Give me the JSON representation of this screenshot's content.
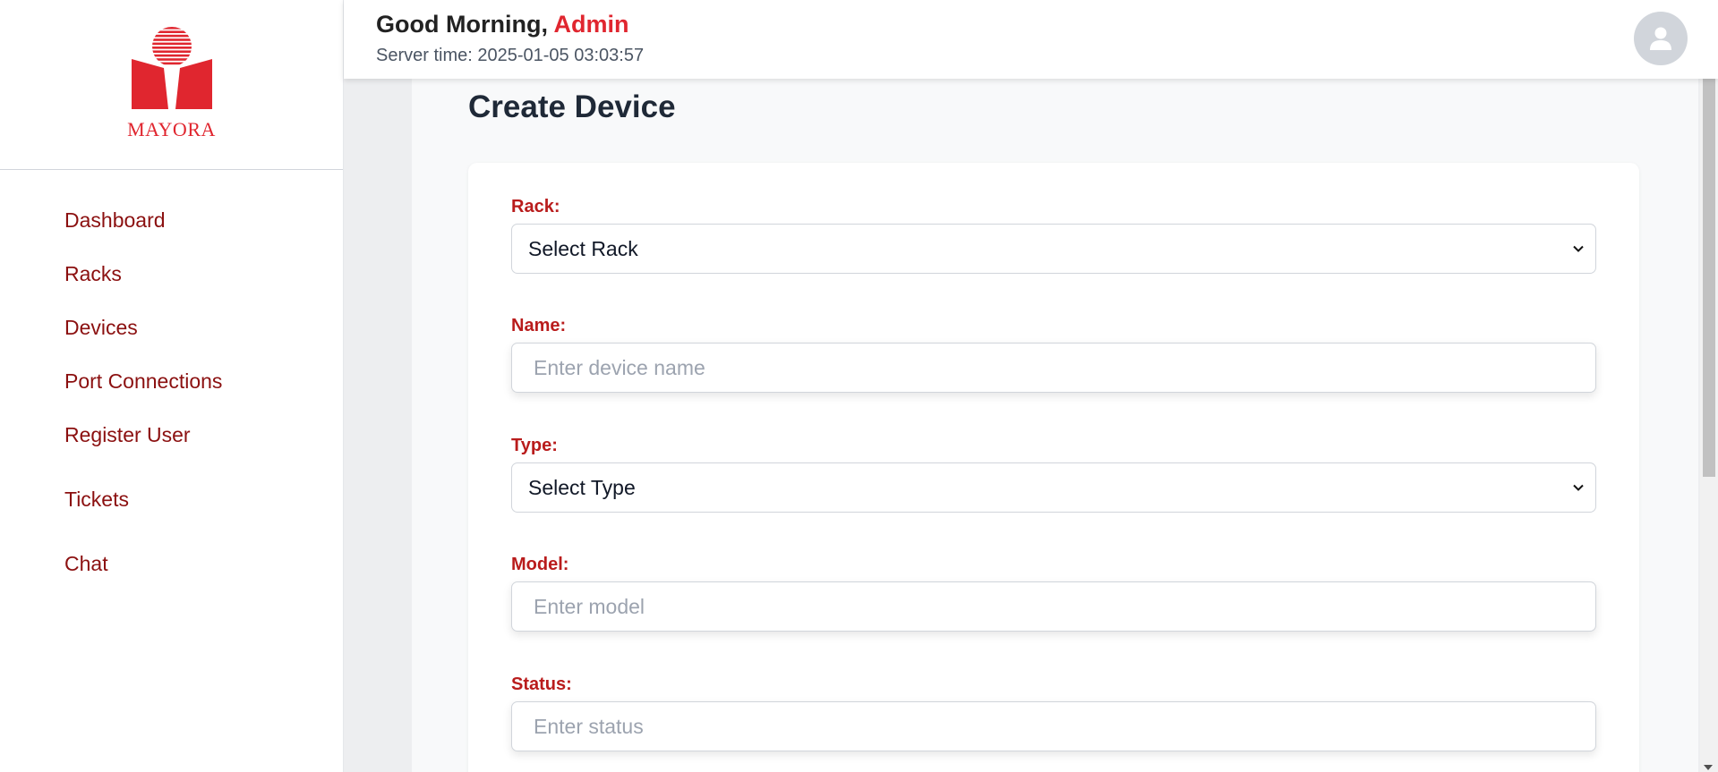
{
  "brand": {
    "name": "MAYORA",
    "color": "#e0262f"
  },
  "sidebar": {
    "items": [
      {
        "label": "Dashboard"
      },
      {
        "label": "Racks"
      },
      {
        "label": "Devices"
      },
      {
        "label": "Port Connections"
      },
      {
        "label": "Register User"
      },
      {
        "label": "Tickets"
      },
      {
        "label": "Chat"
      }
    ]
  },
  "header": {
    "greeting": "Good Morning,",
    "user": "Admin",
    "server_time": "Server time: 2025-01-05 03:03:57",
    "avatar_icon": "user-avatar-icon"
  },
  "page": {
    "title": "Create Device"
  },
  "form": {
    "rack": {
      "label": "Rack:",
      "value": "Select Rack"
    },
    "name": {
      "label": "Name:",
      "placeholder": "Enter device name"
    },
    "type": {
      "label": "Type:",
      "value": "Select Type"
    },
    "model": {
      "label": "Model:",
      "placeholder": "Enter model"
    },
    "status": {
      "label": "Status:",
      "placeholder": "Enter status"
    }
  },
  "colors": {
    "accent": "#b91c1c",
    "nav": "#8b1010",
    "admin": "#e0262f"
  }
}
